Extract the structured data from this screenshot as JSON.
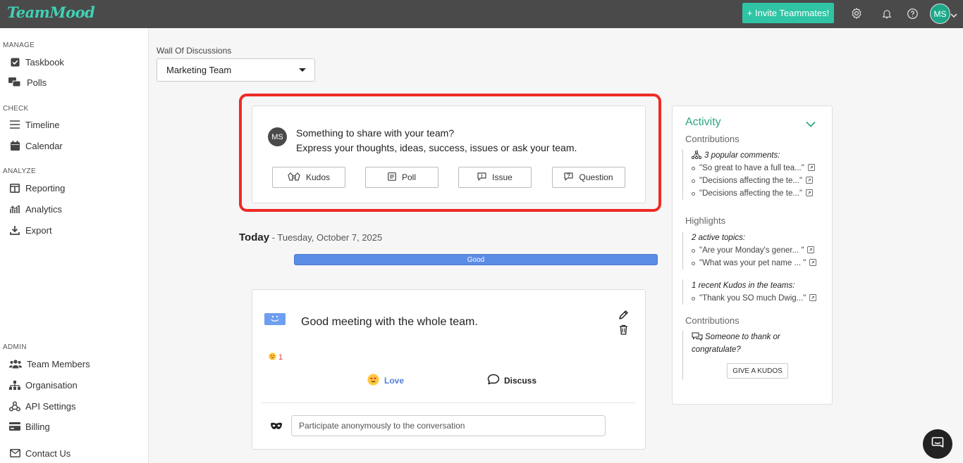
{
  "topbar": {
    "logo": "TeamMood",
    "invite_label": "+ Invite Teammates!",
    "user_initials": "MS",
    "icons": [
      "gear-icon",
      "bell-icon",
      "help-icon",
      "chevron-down-icon"
    ]
  },
  "sidebar": {
    "sections": [
      {
        "label": "MANAGE",
        "items": [
          {
            "label": "Taskbook",
            "icon": "checkbox-icon"
          },
          {
            "label": "Polls",
            "icon": "polls-icon"
          }
        ]
      },
      {
        "label": "CHECK",
        "items": [
          {
            "label": "Timeline",
            "icon": "list-icon"
          },
          {
            "label": "Calendar",
            "icon": "calendar-icon"
          }
        ]
      },
      {
        "label": "ANALYZE",
        "items": [
          {
            "label": "Reporting",
            "icon": "table-icon"
          },
          {
            "label": "Analytics",
            "icon": "analytics-icon"
          },
          {
            "label": "Export",
            "icon": "download-icon"
          }
        ]
      },
      {
        "label": "ADMIN",
        "items": [
          {
            "label": "Team Members",
            "icon": "users-icon"
          },
          {
            "label": "Organisation",
            "icon": "sitemap-icon"
          },
          {
            "label": "API Settings",
            "icon": "webhook-icon"
          },
          {
            "label": "Billing",
            "icon": "credit-card-icon"
          }
        ]
      }
    ],
    "contact": {
      "label": "Contact Us",
      "icon": "mail-icon"
    }
  },
  "wall": {
    "label": "Wall Of Discussions",
    "selected_team": "Marketing Team"
  },
  "share": {
    "avatar": "MS",
    "line1": "Something to share with your team?",
    "line2": "Express your thoughts, ideas, success, issues or ask your team.",
    "buttons": [
      {
        "label": "Kudos",
        "icon": "kudos-icon"
      },
      {
        "label": "Poll",
        "icon": "poll-icon"
      },
      {
        "label": "Issue",
        "icon": "issue-icon"
      },
      {
        "label": "Question",
        "icon": "question-icon"
      }
    ]
  },
  "today": {
    "label": "Today",
    "date": " - Tuesday, October 7, 2025",
    "mood_label": "Good",
    "mood_color": "#5b8ce6"
  },
  "post": {
    "text": "Good meeting with the whole team.",
    "reaction_count": "1",
    "love_label": "Love",
    "discuss_label": "Discuss",
    "anon_placeholder": "Participate anonymously to the conversation"
  },
  "activity": {
    "title": "Activity",
    "contributions_label": "Contributions",
    "popular_head": "3 popular comments:",
    "popular_items": [
      "\"So great to have a full tea...\"",
      "\"Decisions affecting the te...\"",
      "\"Decisions affecting the te...\""
    ],
    "highlights_label": "Highlights",
    "topics_head": "2 active topics:",
    "topics_items": [
      "\"Are your Monday's gener... \"",
      "\"What was your pet name ... \""
    ],
    "kudos_head": "1 recent Kudos in the teams:",
    "kudos_items": [
      "\"Thank you SO much Dwig...\""
    ],
    "contributions2_label": "Contributions",
    "thank_text_1": "Someone to thank or",
    "thank_text_2": "congratulate?",
    "give_kudos": "GIVE A KUDOS"
  },
  "colors": {
    "topbar": "#4a4a4a",
    "brand": "#2ec4a4",
    "highlight": "#ee2b24",
    "mood_good": "#5b8ce6"
  }
}
